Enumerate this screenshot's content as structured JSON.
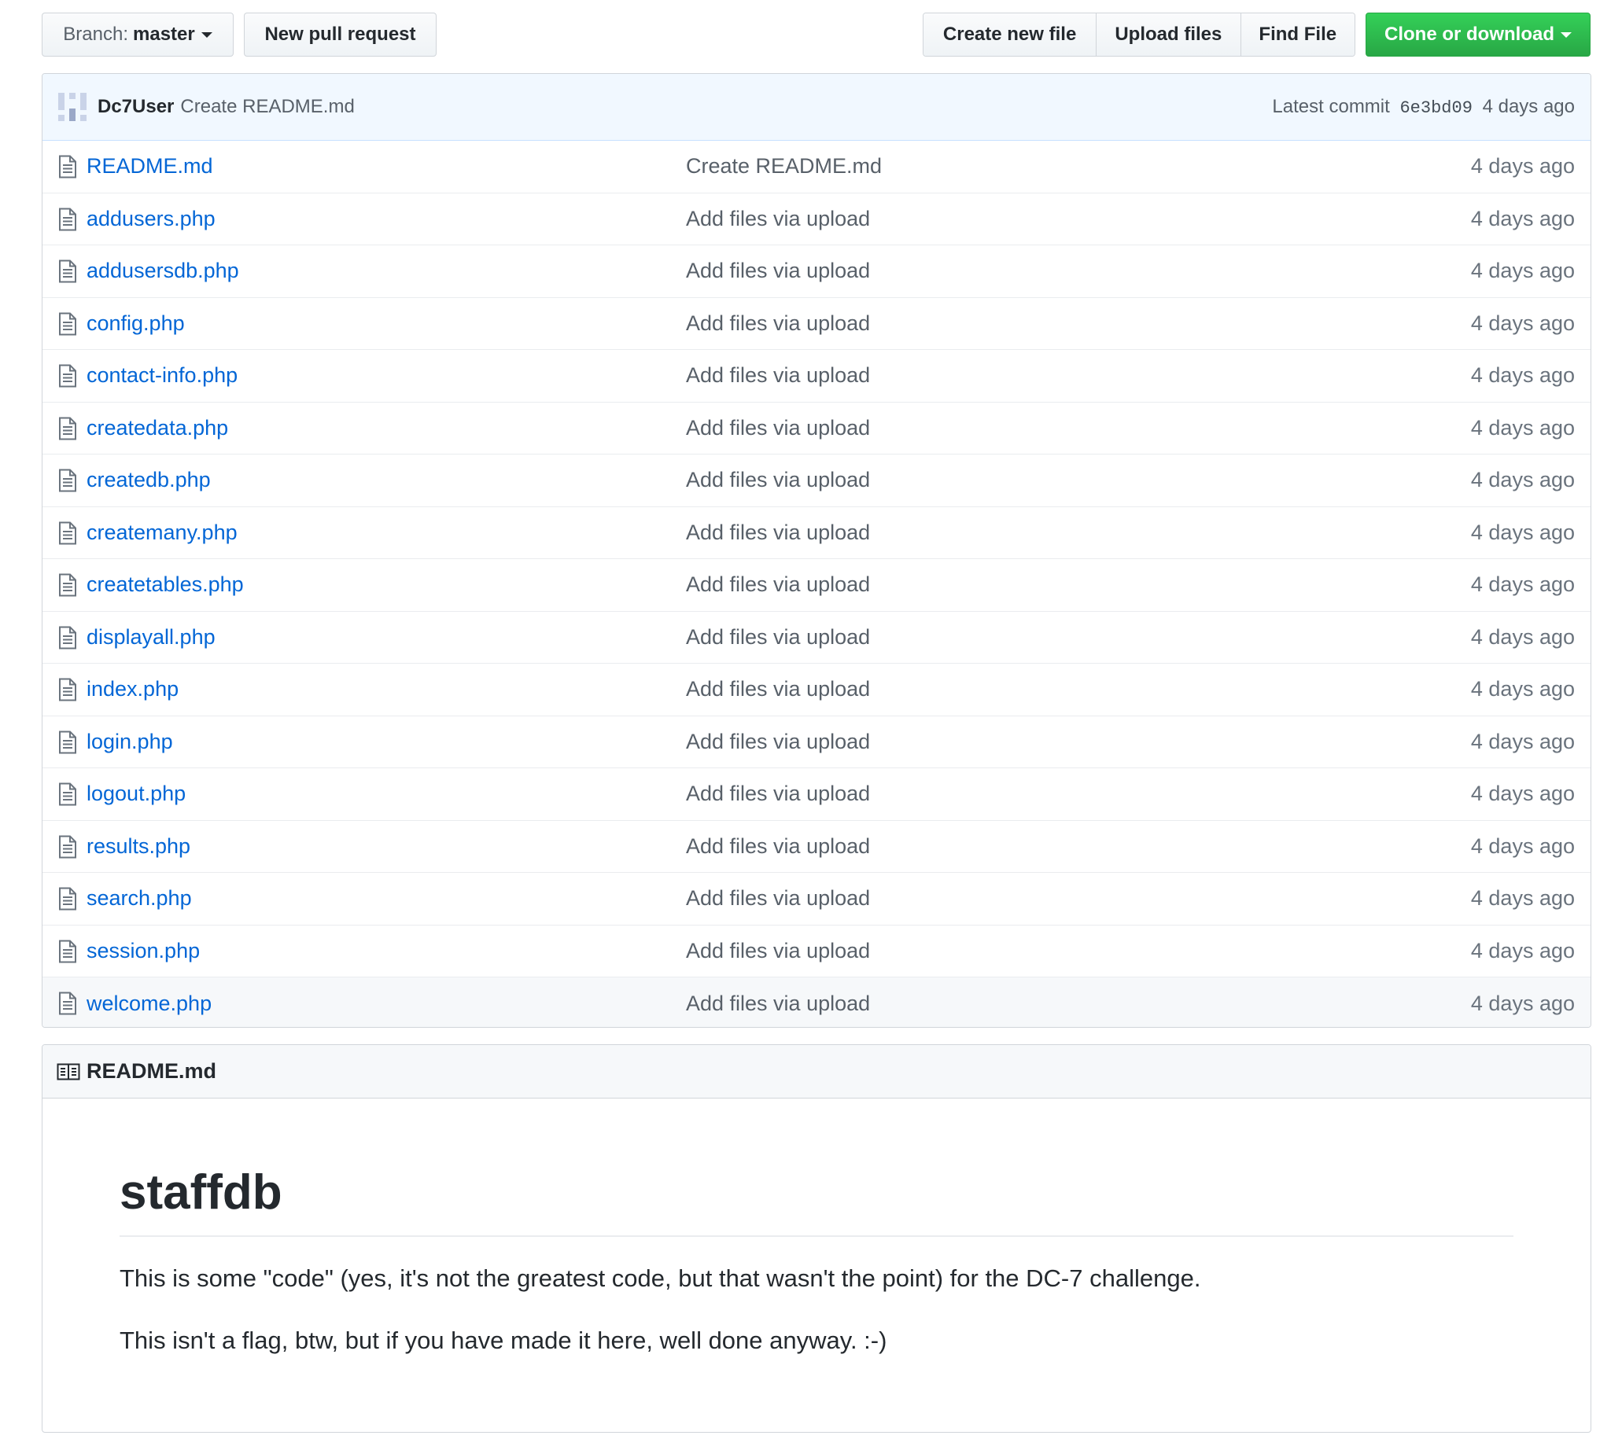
{
  "toolbar": {
    "branch_prefix": "Branch:",
    "branch_name": "master",
    "new_pull_request": "New pull request",
    "create_new_file": "Create new file",
    "upload_files": "Upload files",
    "find_file": "Find File",
    "clone_or_download": "Clone or download"
  },
  "commit": {
    "author": "Dc7User",
    "message": "Create README.md",
    "latest_label": "Latest commit",
    "sha": "6e3bd09",
    "age": "4 days ago"
  },
  "files": [
    {
      "name": "README.md",
      "message": "Create README.md",
      "age": "4 days ago"
    },
    {
      "name": "addusers.php",
      "message": "Add files via upload",
      "age": "4 days ago"
    },
    {
      "name": "addusersdb.php",
      "message": "Add files via upload",
      "age": "4 days ago"
    },
    {
      "name": "config.php",
      "message": "Add files via upload",
      "age": "4 days ago"
    },
    {
      "name": "contact-info.php",
      "message": "Add files via upload",
      "age": "4 days ago"
    },
    {
      "name": "createdata.php",
      "message": "Add files via upload",
      "age": "4 days ago"
    },
    {
      "name": "createdb.php",
      "message": "Add files via upload",
      "age": "4 days ago"
    },
    {
      "name": "createmany.php",
      "message": "Add files via upload",
      "age": "4 days ago"
    },
    {
      "name": "createtables.php",
      "message": "Add files via upload",
      "age": "4 days ago"
    },
    {
      "name": "displayall.php",
      "message": "Add files via upload",
      "age": "4 days ago"
    },
    {
      "name": "index.php",
      "message": "Add files via upload",
      "age": "4 days ago"
    },
    {
      "name": "login.php",
      "message": "Add files via upload",
      "age": "4 days ago"
    },
    {
      "name": "logout.php",
      "message": "Add files via upload",
      "age": "4 days ago"
    },
    {
      "name": "results.php",
      "message": "Add files via upload",
      "age": "4 days ago"
    },
    {
      "name": "search.php",
      "message": "Add files via upload",
      "age": "4 days ago"
    },
    {
      "name": "session.php",
      "message": "Add files via upload",
      "age": "4 days ago"
    },
    {
      "name": "welcome.php",
      "message": "Add files via upload",
      "age": "4 days ago"
    }
  ],
  "readme": {
    "header": "README.md",
    "title": "staffdb",
    "paragraphs": [
      "This is some \"code\" (yes, it's not the greatest code, but that wasn't the point) for the DC-7 challenge.",
      "This isn't a flag, btw, but if you have made it here, well done anyway. :-)"
    ]
  },
  "icons": {
    "file": "file-icon",
    "book": "book-icon",
    "caret": "caret-down-icon"
  },
  "colors": {
    "link": "#0366d6",
    "clone_button": "#28a745",
    "commit_bar": "#f1f8ff"
  }
}
